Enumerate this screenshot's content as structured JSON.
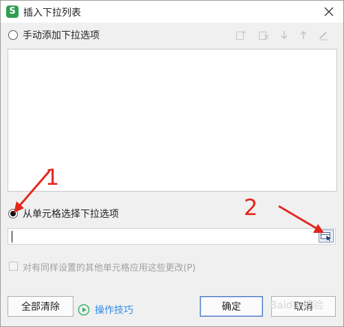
{
  "window": {
    "title": "插入下拉列表"
  },
  "options": {
    "manual": {
      "label": "手动添加下拉选项",
      "checked": false
    },
    "from_cells": {
      "label": "从单元格选择下拉选项",
      "checked": true
    }
  },
  "toolbar": {
    "icons": [
      "add-item-icon",
      "delete-item-icon",
      "move-down-icon",
      "move-up-icon",
      "edit-icon"
    ]
  },
  "range_input": {
    "value": ""
  },
  "apply_checkbox": {
    "label": "对有同样设置的其他单元格应用这些更改(P)",
    "checked": false
  },
  "buttons": {
    "clear_all": "全部清除",
    "tips": "操作技巧",
    "ok": "确定",
    "cancel": "取消"
  },
  "annotations": {
    "marker1": "1",
    "marker2": "2"
  },
  "watermark": "Baidu 经验",
  "colors": {
    "annotation_red": "#e3271d",
    "link_blue": "#2f8ce6",
    "app_green": "#2e9e4f"
  }
}
